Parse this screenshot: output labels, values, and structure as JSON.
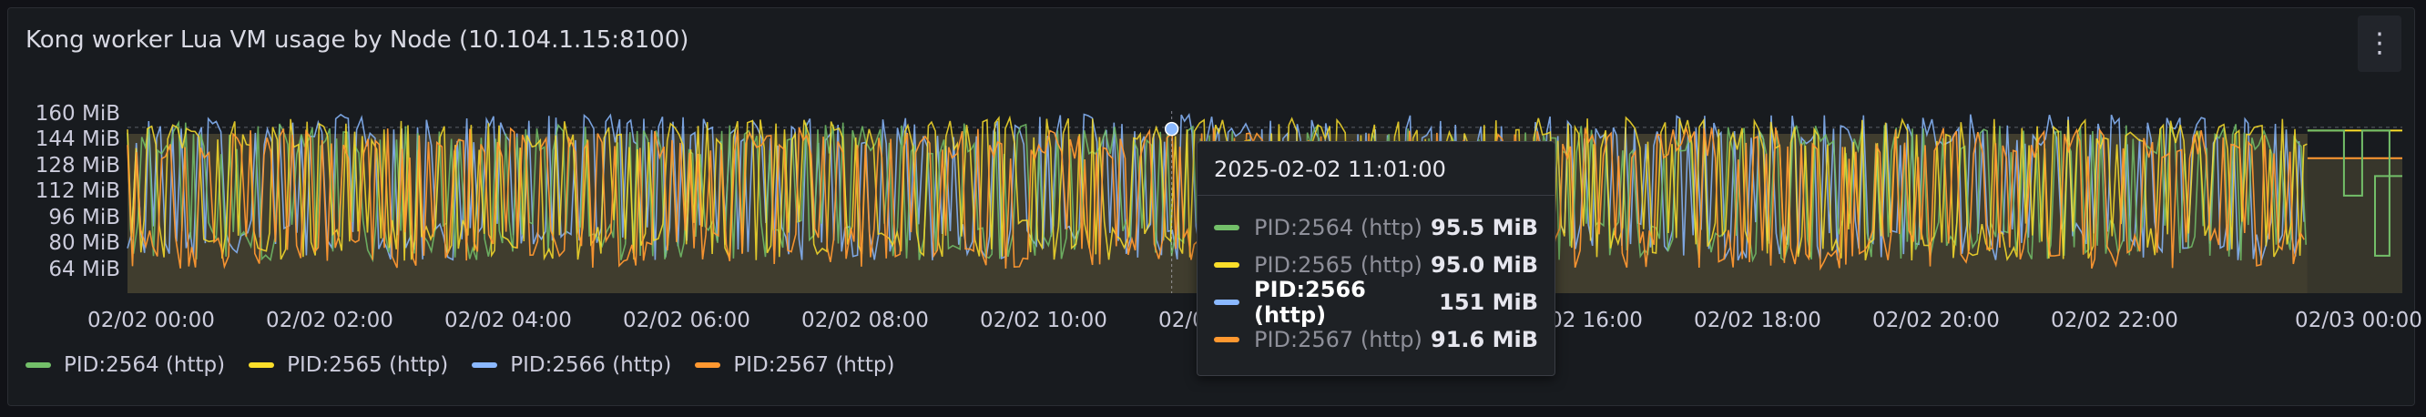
{
  "panel": {
    "title": "Kong worker Lua VM usage by Node (10.104.1.15:8100)",
    "menu_icon": "kebab-menu-icon"
  },
  "colors": {
    "background": "#111217",
    "panel": "#181b1f",
    "fill": "#4d4a34",
    "series": [
      "#73bf69",
      "#fade2a",
      "#8ab8ff",
      "#ff9830"
    ]
  },
  "legend": [
    {
      "label": "PID:2564 (http)",
      "color": "#73bf69"
    },
    {
      "label": "PID:2565 (http)",
      "color": "#fade2a"
    },
    {
      "label": "PID:2566 (http)",
      "color": "#8ab8ff"
    },
    {
      "label": "PID:2567 (http)",
      "color": "#ff9830"
    }
  ],
  "tooltip": {
    "time": "2025-02-02 11:01:00",
    "rows": [
      {
        "label": "PID:2564 (http)",
        "value": "95.5 MiB",
        "color": "#73bf69",
        "active": false
      },
      {
        "label": "PID:2565 (http)",
        "value": "95.0 MiB",
        "color": "#fade2a",
        "active": false
      },
      {
        "label": "PID:2566 (http)",
        "value": "151 MiB",
        "color": "#8ab8ff",
        "active": true
      },
      {
        "label": "PID:2567 (http)",
        "value": "91.6 MiB",
        "color": "#ff9830",
        "active": false
      }
    ]
  },
  "chart_data": {
    "type": "line",
    "y_unit": "MiB",
    "yticks": [
      "160 MiB",
      "144 MiB",
      "128 MiB",
      "112 MiB",
      "96 MiB",
      "80 MiB",
      "64 MiB"
    ],
    "ytick_values": [
      160,
      144,
      128,
      112,
      96,
      80,
      64
    ],
    "xticks": [
      "02/02 00:00",
      "02/02 02:00",
      "02/02 04:00",
      "02/02 06:00",
      "02/02 08:00",
      "02/02 10:00",
      "02/02 12:00",
      "02/02 14:00",
      "02/02 16:00",
      "02/02 18:00",
      "02/02 20:00",
      "02/02 22:00",
      "02/03 00:00"
    ],
    "ylim": [
      50,
      162
    ],
    "xlim": [
      "2025-02-02 00:00",
      "2025-02-03 00:00"
    ],
    "fill_area": true,
    "legend_position": "bottom",
    "series": [
      {
        "name": "PID:2564 (http)",
        "range_mib": [
          70,
          155
        ],
        "end_values": [
          {
            "time": "2025-02-02 23:00",
            "value": 135
          },
          {
            "time": "2025-02-02 23:30",
            "value": 73
          },
          {
            "time": "2025-02-02 23:50",
            "value": 122
          }
        ]
      },
      {
        "name": "PID:2565 (http)",
        "range_mib": [
          70,
          158
        ],
        "end_values": [
          {
            "time": "2025-02-02 23:00",
            "value": 150
          }
        ]
      },
      {
        "name": "PID:2566 (http)",
        "range_mib": [
          70,
          160
        ],
        "hover_value": 151
      },
      {
        "name": "PID:2567 (http)",
        "range_mib": [
          65,
          152
        ],
        "end_values": [
          {
            "time": "2025-02-02 23:00",
            "value": 133
          }
        ]
      }
    ],
    "hover_time": "2025-02-02 11:01:00"
  }
}
